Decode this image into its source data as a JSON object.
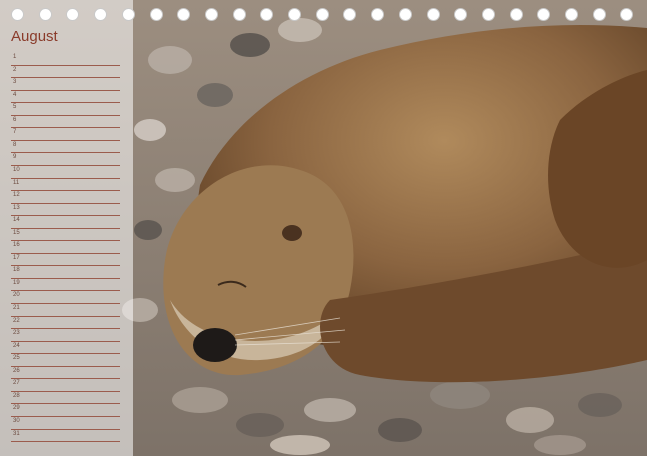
{
  "calendar": {
    "month": "August",
    "days": [
      "1",
      "2",
      "3",
      "4",
      "5",
      "6",
      "7",
      "8",
      "9",
      "10",
      "11",
      "12",
      "13",
      "14",
      "15",
      "16",
      "17",
      "18",
      "19",
      "20",
      "21",
      "22",
      "23",
      "24",
      "25",
      "26",
      "27",
      "28",
      "29",
      "30",
      "31"
    ]
  },
  "photo": {
    "subject": "otter-sleeping-on-pebbles"
  },
  "colors": {
    "month_text": "#8a3b2a",
    "rule_line": "#9b5c4d",
    "panel_overlay": "rgba(255,255,255,0.55)"
  }
}
